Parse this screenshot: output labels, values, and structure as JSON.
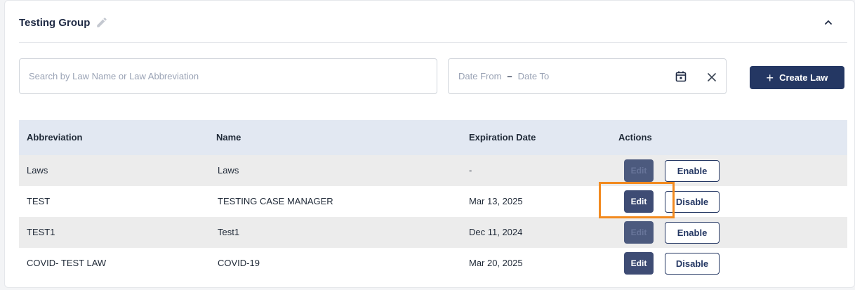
{
  "header": {
    "title": "Testing Group",
    "edit_icon": "pencil-icon",
    "collapse_icon": "chevron-up-icon"
  },
  "filters": {
    "search_placeholder": "Search by Law Name or Law Abbreviation",
    "search_value": "",
    "date_from_placeholder": "Date From",
    "date_separator": "–",
    "date_to_placeholder": "Date To",
    "calendar_icon": "calendar-icon",
    "clear_icon": "close-icon"
  },
  "create_button": {
    "icon": "plus-icon",
    "symbol": "+",
    "label": "Create Law"
  },
  "table": {
    "columns": [
      "Abbreviation",
      "Name",
      "Expiration Date",
      "Actions"
    ],
    "rows": [
      {
        "abbreviation": "Laws",
        "name": "Laws",
        "expiration": "-",
        "edit_label": "Edit",
        "edit_enabled": false,
        "toggle_label": "Enable"
      },
      {
        "abbreviation": "TEST",
        "name": "TESTING CASE MANAGER",
        "expiration": "Mar 13, 2025",
        "edit_label": "Edit",
        "edit_enabled": true,
        "toggle_label": "Disable"
      },
      {
        "abbreviation": "TEST1",
        "name": "Test1",
        "expiration": "Dec 11, 2024",
        "edit_label": "Edit",
        "edit_enabled": false,
        "toggle_label": "Enable"
      },
      {
        "abbreviation": "COVID- TEST LAW",
        "name": "COVID-19",
        "expiration": "Mar 20, 2025",
        "edit_label": "Edit",
        "edit_enabled": true,
        "toggle_label": "Disable"
      }
    ]
  },
  "colors": {
    "primary": "#243763",
    "highlight": "#f28a1f",
    "header_bg": "#e2e8f2",
    "alt_row_bg": "#ececec"
  }
}
